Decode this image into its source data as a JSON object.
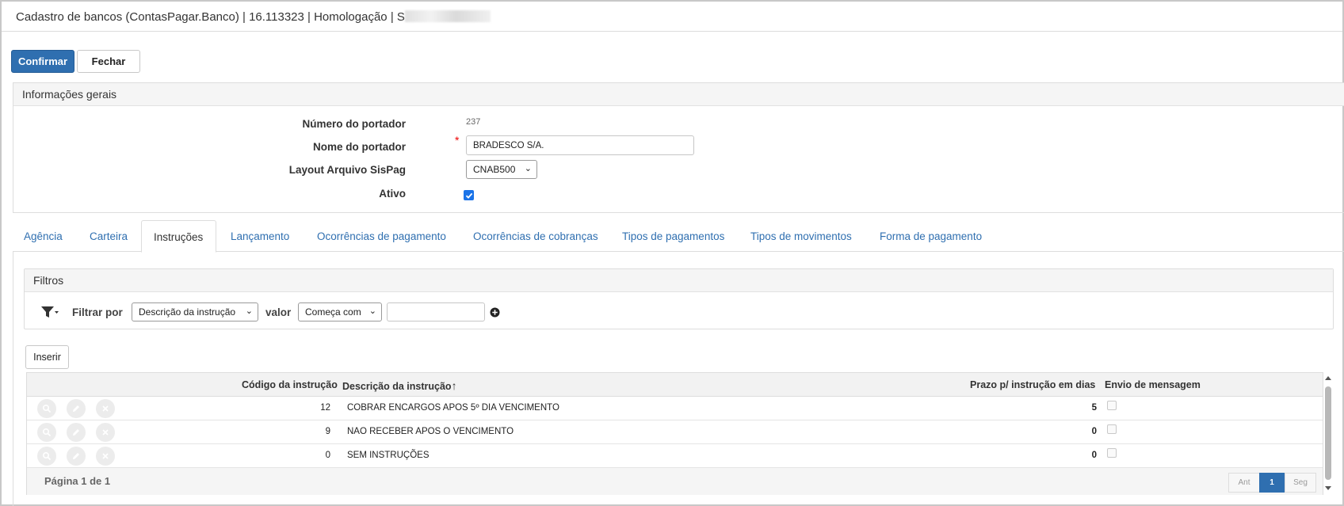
{
  "window": {
    "title": "Cadastro de bancos (ContasPagar.Banco) | 16.113323 | Homologação | S"
  },
  "toolbar": {
    "confirm_label": "Confirmar",
    "close_label": "Fechar"
  },
  "general": {
    "heading": "Informações gerais",
    "number_label": "Número do portador",
    "number_value": "237",
    "name_label": "Nome do portador",
    "name_value": "BRADESCO S/A.",
    "required_mark": "*",
    "layout_label": "Layout Arquivo SisPag",
    "layout_value": "CNAB500",
    "active_label": "Ativo",
    "active_checked": true
  },
  "tabs": [
    {
      "label": "Agência"
    },
    {
      "label": "Carteira"
    },
    {
      "label": "Instruções"
    },
    {
      "label": "Lançamento"
    },
    {
      "label": "Ocorrências de pagamento"
    },
    {
      "label": "Ocorrências de cobranças"
    },
    {
      "label": "Tipos de pagamentos"
    },
    {
      "label": "Tipos de movimentos"
    },
    {
      "label": "Forma de pagamento"
    }
  ],
  "active_tab": "Instruções",
  "filters": {
    "heading": "Filtros",
    "filter_by_label": "Filtrar por",
    "field_value": "Descrição da instrução",
    "value_label": "valor",
    "operator_value": "Começa com",
    "search_value": ""
  },
  "insert_label": "Inserir",
  "grid": {
    "columns": {
      "code": "Código da instrução",
      "description": "Descrição da instrução",
      "sort_indicator": "↑",
      "days": "Prazo p/ instrução em dias",
      "message": "Envio de mensagem"
    },
    "rows": [
      {
        "code": "12",
        "description": "COBRAR ENCARGOS APOS 5º DIA VENCIMENTO",
        "days": "5",
        "message": false
      },
      {
        "code": "9",
        "description": "NAO RECEBER APOS O VENCIMENTO",
        "days": "0",
        "message": false
      },
      {
        "code": "0",
        "description": "SEM INSTRUÇÕES",
        "days": "0",
        "message": false
      }
    ],
    "page_info": "Página 1 de 1",
    "pager": {
      "prev": "Ant",
      "current": "1",
      "next": "Seg"
    }
  },
  "colors": {
    "primary": "#2f6fb0",
    "link": "#2f6fb0",
    "required": "#e00000"
  }
}
